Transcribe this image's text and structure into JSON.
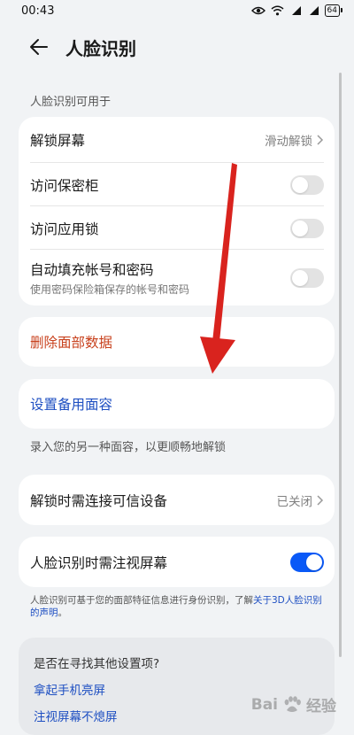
{
  "status_bar": {
    "time": "00:43",
    "battery": "64"
  },
  "header": {
    "title": "人脸识别"
  },
  "section": {
    "label": "人脸识别可用于"
  },
  "usage_items": {
    "unlock_screen": {
      "label": "解锁屏幕",
      "value": "滑动解锁"
    },
    "vault": {
      "label": "访问保密柜",
      "enabled": false
    },
    "app_lock": {
      "label": "访问应用锁",
      "enabled": false
    },
    "autofill": {
      "label": "自动填充帐号和密码",
      "sub": "使用密码保险箱保存的帐号和密码",
      "enabled": false
    }
  },
  "delete_data": {
    "label": "删除面部数据"
  },
  "alt_face": {
    "label": "设置备用面容",
    "helper": "录入您的另一种面容，以更顺畅地解锁"
  },
  "trusted_device": {
    "label": "解锁时需连接可信设备",
    "value": "已关闭"
  },
  "gaze": {
    "label": "人脸识别时需注视屏幕",
    "enabled": true
  },
  "footnote": {
    "text": "人脸识别可基于您的面部特征信息进行身份识别，了解",
    "link": "关于3D人脸识别的声明",
    "end": "。"
  },
  "suggestions": {
    "title": "是否在寻找其他设置项?",
    "links": [
      "拿起手机亮屏",
      "注视屏幕不熄屏"
    ]
  },
  "watermark": {
    "text": "Bai",
    "text2": "经验"
  },
  "colors": {
    "accent": "#0A59F7",
    "link": "#1E4FC2",
    "danger": "#C8421E",
    "annotation_arrow": "#D9231E"
  }
}
